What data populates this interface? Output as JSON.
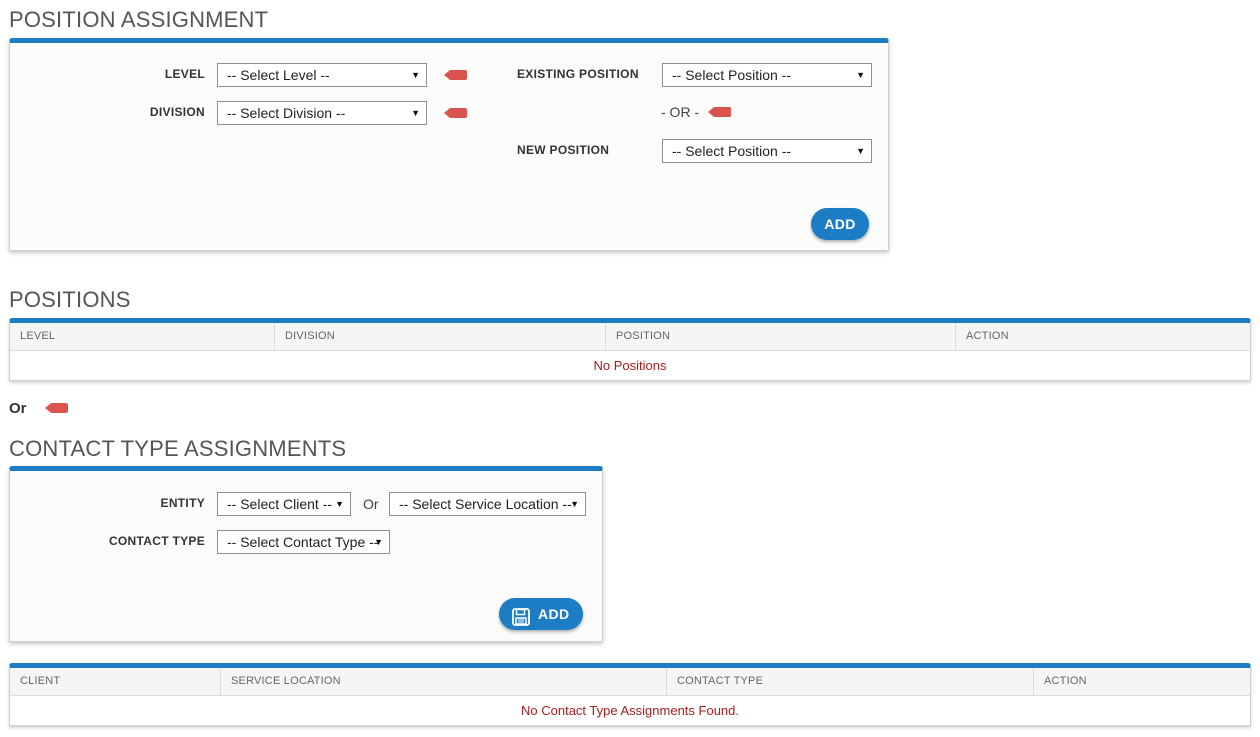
{
  "position_assignment": {
    "title": "POSITION ASSIGNMENT",
    "level_label": "LEVEL",
    "level_value": "-- Select Level --",
    "division_label": "DIVISION",
    "division_value": "-- Select Division --",
    "existing_position_label": "EXISTING POSITION",
    "existing_position_value": "-- Select Position --",
    "or_label": "- OR -",
    "new_position_label": "NEW POSITION",
    "new_position_value": "-- Select Position --",
    "add_label": "ADD"
  },
  "positions": {
    "title": "POSITIONS",
    "columns": [
      "LEVEL",
      "DIVISION",
      "POSITION",
      "ACTION"
    ],
    "empty_message": "No Positions"
  },
  "or_divider": "Or",
  "contact_type_assignments": {
    "title": "CONTACT TYPE ASSIGNMENTS",
    "entity_label": "ENTITY",
    "client_value": "-- Select Client --",
    "or_label": "Or",
    "service_location_value": "-- Select Service Location --",
    "contact_type_label": "CONTACT TYPE",
    "contact_type_value": "-- Select Contact Type --",
    "add_label": "ADD"
  },
  "contact_table": {
    "columns": [
      "CLIENT",
      "SERVICE LOCATION",
      "CONTACT TYPE",
      "ACTION"
    ],
    "empty_message": "No Contact Type Assignments Found."
  },
  "colors": {
    "accent": "#1c7cc4",
    "required_marker": "#d9534f",
    "empty_text": "#a12020"
  },
  "icons": {
    "required_marker": "tag-marker-icon",
    "dropdown": "caret-down-icon",
    "save": "floppy-disk-icon"
  }
}
